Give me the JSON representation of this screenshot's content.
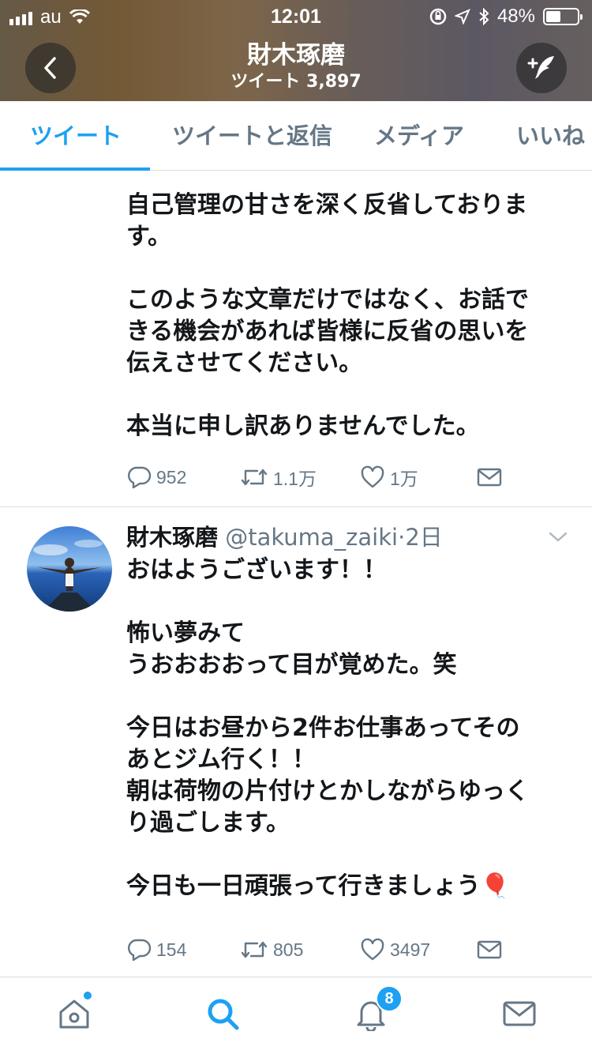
{
  "status_bar": {
    "carrier": "au",
    "time": "12:01",
    "battery": "48%",
    "battery_level": 0.48
  },
  "header": {
    "name": "財木琢磨",
    "tweet_count_label": "ツイート 3,897",
    "back_icon": "chevron-left-icon",
    "compose_icon": "compose-tweet-icon"
  },
  "tabs": [
    {
      "label": "ツイート",
      "active": true
    },
    {
      "label": "ツイートと返信",
      "active": false
    },
    {
      "label": "メディア",
      "active": false
    },
    {
      "label": "いいね",
      "active": false
    }
  ],
  "tweets": [
    {
      "text": "自己管理の甘さを深く反省しておりま\nす。\n\nこのような文章だけではなく、お話で\nきる機会があれば皆様に反省の思いを\n伝えさせてください。\n\n本当に申し訳ありませんでした。",
      "replies": "952",
      "retweets": "1.1万",
      "likes": "1万"
    },
    {
      "author_name": "財木琢磨",
      "author_handle": "@takuma_zaiki",
      "separator": "·",
      "time": "2日",
      "text": "おはようございます！！\n\n怖い夢みて\nうおおおおって目が覚めた。笑\n\n今日はお昼から2件お仕事あってその\nあとジム行く！！\n朝は荷物の片付けとかしながらゆっく\nり過ごします。\n\n今日も一日頑張って行きましょう🎈",
      "replies": "154",
      "retweets": "805",
      "likes": "3497"
    }
  ],
  "bottom_nav": {
    "items": [
      "home-icon",
      "search-icon",
      "notifications-icon",
      "messages-icon"
    ],
    "notification_count": "8",
    "active_color": "#1da1f2"
  }
}
